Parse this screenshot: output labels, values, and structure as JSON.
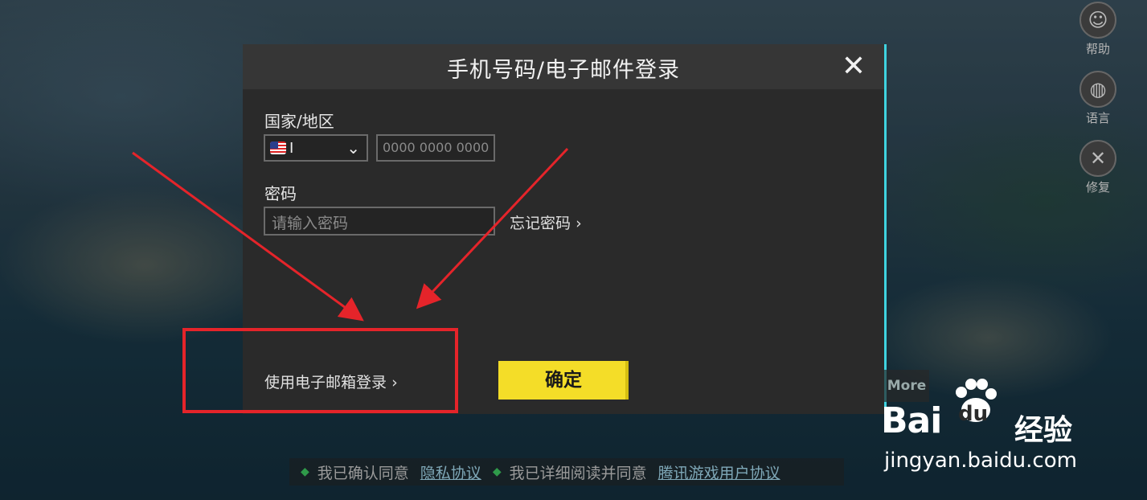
{
  "modal": {
    "title": "手机号码/电子邮件登录",
    "close_icon": "close-icon",
    "country_label": "国家/地区",
    "country_code": "I",
    "phone_placeholder": "0000 0000 0000",
    "password_label": "密码",
    "password_placeholder": "请输入密码",
    "forgot_password": "忘记密码",
    "email_login": "使用电子邮箱登录",
    "confirm": "确定"
  },
  "side_menu": [
    {
      "icon": "help-icon",
      "label": "帮助"
    },
    {
      "icon": "globe-icon",
      "label": "语言"
    },
    {
      "icon": "wrench-icon",
      "label": "修复"
    }
  ],
  "more_button": "More",
  "consent": {
    "agreed_privacy": "我已确认同意",
    "privacy_link": "隐私协议",
    "agreed_terms": "我已详细阅读并同意",
    "terms_link": "腾讯游戏用户协议"
  },
  "watermark": {
    "brand": "Bai",
    "brand_paw": "du",
    "product": "经验",
    "url": "jingyan.baidu.com"
  },
  "colors": {
    "annotation": "#e5242a",
    "confirm_button": "#f4dd28",
    "accent_edge": "#3fd3e0"
  }
}
